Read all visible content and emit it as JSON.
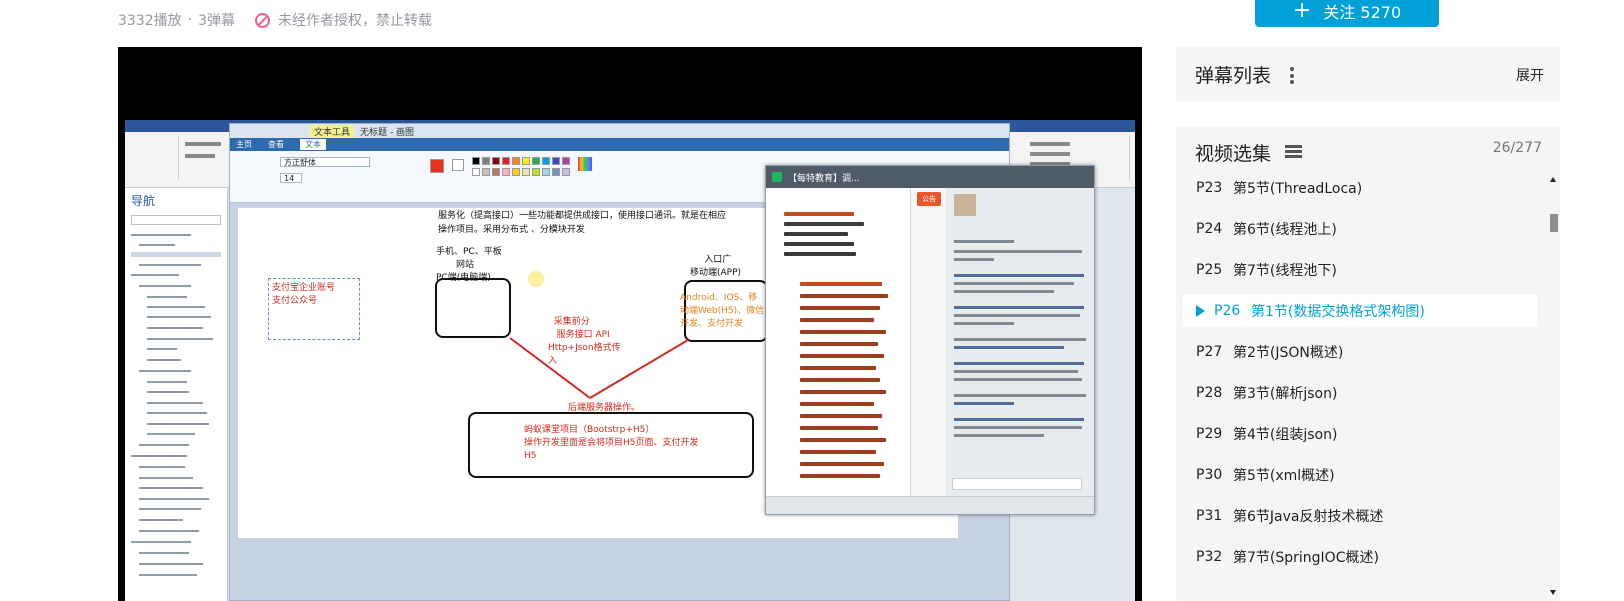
{
  "meta": {
    "plays": "3332播放",
    "separator": "·",
    "danmaku_count": "3弹幕",
    "copyright_notice": "未经作者授权，禁止转载"
  },
  "follow_button": {
    "label": "关注 5270",
    "icon": "plus-icon"
  },
  "danmaku_panel": {
    "title": "弹幕列表",
    "expand_label": "展开",
    "menu_icon": "kebab-menu-icon"
  },
  "playlist": {
    "title": "视频选集",
    "icon": "list-icon",
    "progress": "26/277",
    "active_color": "#00a1d6",
    "episodes": [
      {
        "num": "P23",
        "title": "第5节(ThreadLoca)"
      },
      {
        "num": "P24",
        "title": "第6节(线程池上)"
      },
      {
        "num": "P25",
        "title": "第7节(线程池下)"
      },
      {
        "num": "P26",
        "title": "第1节(数据交换格式架构图)",
        "active": true
      },
      {
        "num": "P27",
        "title": "第2节(JSON概述)"
      },
      {
        "num": "P28",
        "title": "第3节(解析json)"
      },
      {
        "num": "P29",
        "title": "第4节(组装json)"
      },
      {
        "num": "P30",
        "title": "第5节(xml概述)"
      },
      {
        "num": "P31",
        "title": "第6节Java反射技术概述"
      },
      {
        "num": "P32",
        "title": "第7节(SpringIOC概述)"
      }
    ]
  },
  "video": {
    "word_window": {
      "nav_title": "导航"
    },
    "paint_window": {
      "title_tool_tab": "文本工具",
      "title_file": "无标题 - 画图",
      "tabs": [
        "主页",
        "查看",
        "文本"
      ],
      "font_name": "方正舒体",
      "font_size": "14"
    },
    "diagram": {
      "heading_line1": "服务化（提高接口）一些功能都提供成接口，使用接口通讯。就是在相应",
      "heading_line2": "操作项目。采用分布式 、分模块开发",
      "pc_note": "手机、PC、平板\n       网站\nPC端(电脑端)",
      "mobile_note": "     入口广\n移动端(APP)",
      "mobile_detail": "Android、IOS、移\n动端Web(H5)、微信\n开发、支付开发",
      "left_note": "支付宝企业账号\n支付公众号",
      "middle_note": "  采集前分\n   服务接口 API\nHttp+Json格式传\n入",
      "backend_label": "后端服务器操作。",
      "backend_detail": "蚂蚁课堂项目（Bootstrp+H5）\n操作开发里面是会将项目H5页面、支付开发\nH5"
    },
    "chat_window": {
      "title": "【每特教育】调...",
      "tab_label": "公告"
    }
  }
}
